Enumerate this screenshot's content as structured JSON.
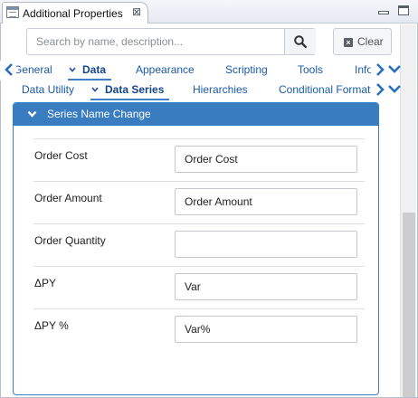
{
  "view": {
    "title": "Additional Properties",
    "close_glyph": "⊠"
  },
  "search": {
    "placeholder": "Search by name, description...",
    "value": "",
    "clear_label": "Clear"
  },
  "main_tabs": [
    {
      "label": "General",
      "active": false
    },
    {
      "label": "Data",
      "active": true
    },
    {
      "label": "Appearance",
      "active": false
    },
    {
      "label": "Scripting",
      "active": false
    },
    {
      "label": "Tools",
      "active": false
    },
    {
      "label": "Info",
      "active": false
    }
  ],
  "sub_tabs": [
    {
      "label": "Data Utility",
      "active": false
    },
    {
      "label": "Data Series",
      "active": true
    },
    {
      "label": "Hierarchies",
      "active": false
    },
    {
      "label": "Conditional Formatting",
      "active": false
    }
  ],
  "section": {
    "title": "Series Name Change",
    "fields": [
      {
        "label": "Order Cost",
        "value": "Order Cost"
      },
      {
        "label": "Order Amount",
        "value": "Order Amount"
      },
      {
        "label": "Order Quantity",
        "value": ""
      },
      {
        "label": "ΔPY",
        "value": "Var"
      },
      {
        "label": "ΔPY %",
        "value": "Var%"
      }
    ]
  },
  "colors": {
    "accent": "#3a7cc0",
    "tab_text": "#1a5aa8"
  },
  "icons": [
    "properties-view-icon",
    "close-icon",
    "minimize-icon",
    "maximize-icon",
    "search-icon",
    "clear-icon",
    "chevron-left-icon",
    "chevron-right-icon",
    "chevron-down-icon"
  ]
}
